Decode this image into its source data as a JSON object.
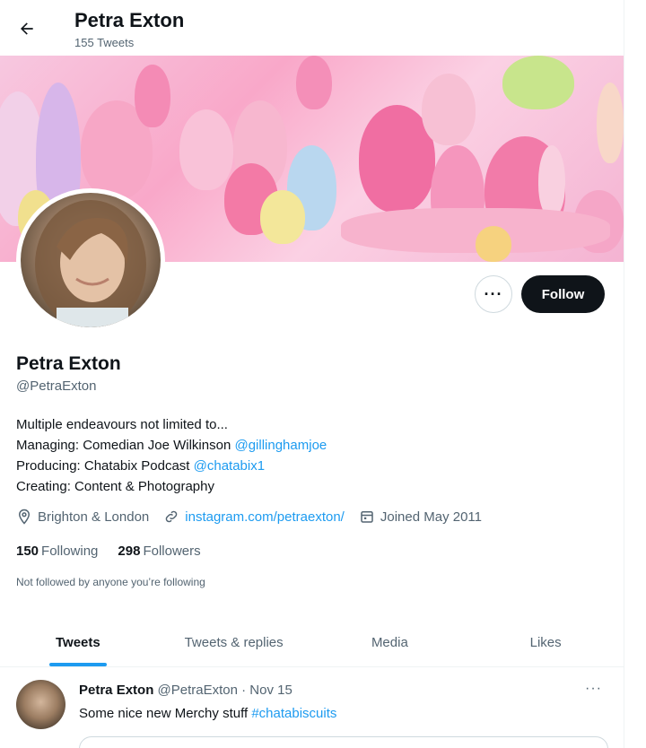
{
  "header": {
    "name": "Petra Exton",
    "tweet_count": "155 Tweets"
  },
  "profile": {
    "name": "Petra Exton",
    "handle": "@PetraExton",
    "follow_label": "Follow",
    "more_label": "···"
  },
  "bio": {
    "line1": "Multiple endeavours not limited to...",
    "line2_prefix": "Managing: Comedian Joe Wilkinson ",
    "line2_link": "@gillinghamjoe",
    "line3_prefix": "Producing: Chatabix Podcast ",
    "line3_link": "@chatabix1",
    "line4": "Creating: Content & Photography"
  },
  "meta": {
    "location": "Brighton & London",
    "website": "instagram.com/petraexton/",
    "joined": "Joined May 2011"
  },
  "stats": {
    "following_count": "150",
    "following_label": "Following",
    "followers_count": "298",
    "followers_label": "Followers"
  },
  "not_followed": "Not followed by anyone you’re following",
  "tabs": [
    {
      "label": "Tweets"
    },
    {
      "label": "Tweets & replies"
    },
    {
      "label": "Media"
    },
    {
      "label": "Likes"
    }
  ],
  "tweet": {
    "author": "Petra Exton",
    "handle_date": "@PetraExton · Nov 15",
    "text_prefix": "Some nice new Merchy stuff ",
    "hashtag": "#chatabiscuits",
    "more_label": "···"
  },
  "colors": {
    "accent": "#1d9bf0",
    "follow_bg": "#0f1419",
    "muted": "#536471"
  },
  "icons": [
    "back-arrow-icon",
    "location-icon",
    "link-icon",
    "calendar-icon"
  ]
}
